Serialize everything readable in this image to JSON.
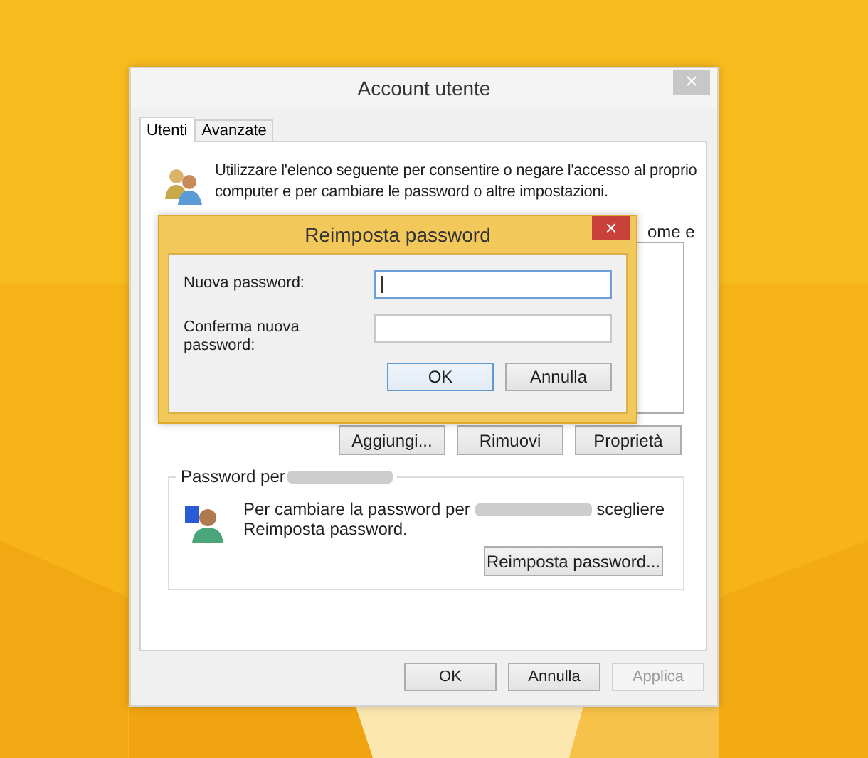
{
  "window": {
    "title": "Account utente",
    "close": "×"
  },
  "tabs": [
    {
      "label": "Utenti",
      "selected": true
    },
    {
      "label": "Avanzate",
      "selected": false
    }
  ],
  "intro": "Utilizzare l'elenco seguente per consentire o negare l'accesso al proprio computer e per cambiare le password o altre impostazioni.",
  "covered_text": "ome e",
  "list_buttons": [
    "Aggiungi...",
    "Rimuovi",
    "Proprietà"
  ],
  "password_group": {
    "legend": "Password per",
    "text_before": "Per cambiare la password per",
    "text_after": "scegliere Reimposta password.",
    "button": "Reimposta password..."
  },
  "footer_buttons": [
    {
      "label": "OK",
      "disabled": false
    },
    {
      "label": "Annulla",
      "disabled": false
    },
    {
      "label": "Applica",
      "disabled": true
    }
  ],
  "dialog": {
    "title": "Reimposta password",
    "close": "×",
    "fields": [
      {
        "label": "Nuova password:",
        "focused": true
      },
      {
        "label": "Conferma nuova password:",
        "focused": false
      }
    ],
    "buttons": [
      {
        "label": "OK",
        "default": true
      },
      {
        "label": "Annulla",
        "default": false
      }
    ]
  }
}
